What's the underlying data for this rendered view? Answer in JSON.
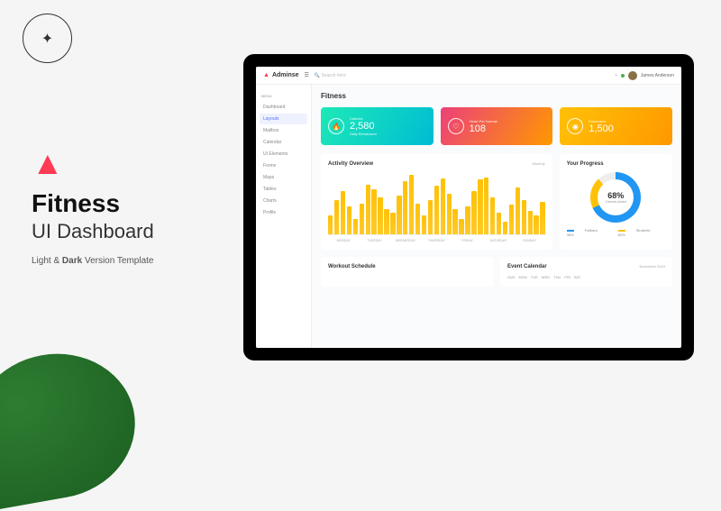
{
  "marketing": {
    "title1": "Fitness",
    "title2": "UI Dashboard",
    "tagline_pre": "Light & ",
    "tagline_bold": "Dark",
    "tagline_post": " Version Template"
  },
  "topbar": {
    "brand": "Adminse",
    "search": "Search here",
    "user": "James Anderson"
  },
  "sidebar": {
    "header": "Menu",
    "items": [
      "Dashboard",
      "Layouts",
      "Mailbox",
      "Calendar",
      "UI Elements",
      "Forms",
      "Maps",
      "Tables",
      "Charts",
      "Profile"
    ]
  },
  "page": {
    "title": "Fitness"
  },
  "cards": [
    {
      "label": "Calories",
      "value": "2,580",
      "sub": "Daily Breakdown",
      "icon": "🔥"
    },
    {
      "label": "Heart Per Normal",
      "value": "108",
      "sub": "",
      "icon": "♡"
    },
    {
      "label": "Kilometers",
      "value": "1,500",
      "sub": "",
      "icon": "◉"
    }
  ],
  "activity": {
    "title": "Activity Overview",
    "filter": "Monthly"
  },
  "progress": {
    "title": "Your Progress",
    "percent": "68%",
    "sub": "Calories Added",
    "legend": [
      {
        "name": "Fullbars",
        "val": "38%"
      },
      {
        "name": "Students",
        "val": "62%"
      }
    ]
  },
  "bottom": {
    "workout": "Workout Schedule",
    "calendar": "Event Calendar",
    "month": "November 2019",
    "days": [
      "SUN",
      "MON",
      "TUE",
      "WED",
      "THU",
      "FRI",
      "SAT"
    ]
  },
  "chart_data": {
    "type": "bar",
    "title": "Activity Overview",
    "categories": [
      "MONDAY",
      "TUESDAY",
      "WEDNESDAY",
      "THURSDAY",
      "FRIDAY",
      "SATURDAY",
      "SUNDAY"
    ],
    "values": [
      30,
      55,
      70,
      45,
      25,
      50,
      80,
      72,
      60,
      40,
      35,
      62,
      85,
      95,
      50,
      30,
      55,
      78,
      90,
      65,
      40,
      25,
      45,
      70,
      88,
      92,
      60,
      35,
      20,
      48,
      75,
      55,
      38,
      30,
      52
    ],
    "ylim": [
      0,
      100
    ]
  }
}
